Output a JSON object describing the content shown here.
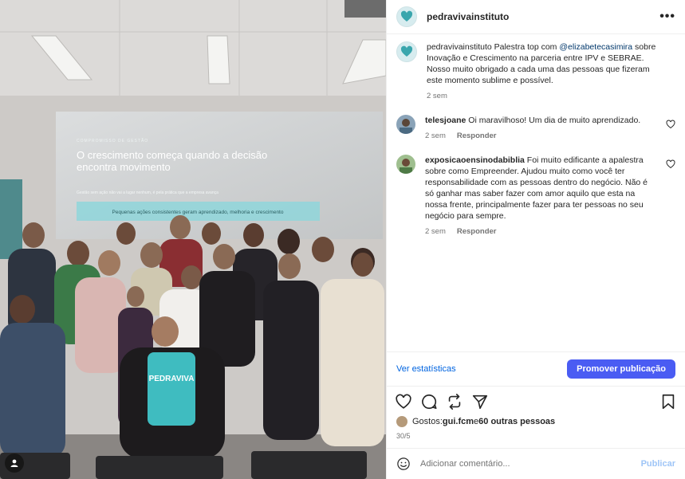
{
  "photo": {
    "slide_kicker": "COMPROMISSO DE GESTÃO",
    "slide_title_line1": "O crescimento começa quando a decisão",
    "slide_title_line2": "encontra movimento",
    "slide_small": "Gestão sem ação não vai a lugar nenhum, é pela prática que a empresa avança",
    "slide_box": "Pequenas ações consistentes geram aprendizado, melhoria e crescimento",
    "shirt_text": "PEDRAVIVA"
  },
  "header": {
    "username": "pedravivainstituto",
    "more_label": "•••"
  },
  "caption": {
    "username": "pedravivainstituto",
    "text_before": " Palestra top com ",
    "mention": "@elizabetecasimira",
    "text_after": " sobre Inovação e Crescimento na parceria entre IPV e SEBRAE. Nosso muito obrigado a cada uma das pessoas que fizeram este momento sublime e possível.",
    "time": "2 sem"
  },
  "comments": [
    {
      "username": "telesjoane",
      "text": " Oi maravilhoso! Um dia de muito aprendizado.",
      "time": "2 sem",
      "reply": "Responder"
    },
    {
      "username": "exposicaoensinodabiblia",
      "text": " Foi muito edificante a apalestra sobre como Empreender. Ajudou muito como você ter responsabilidade com as pessoas dentro do negócio. Não é só ganhar mas saber fazer com amor aquilo que esta na nossa frente, principalmente fazer para ter pessoas no seu negócio para sempre.",
      "time": "2 sem",
      "reply": "Responder"
    }
  ],
  "stats": {
    "link": "Ver estatísticas",
    "promote": "Promover publicação"
  },
  "likes": {
    "prefix": "Gostos: ",
    "user": "gui.fcm",
    "middle": " e ",
    "others": "60 outras pessoas"
  },
  "date": "30/5",
  "add_comment": {
    "placeholder": "Adicionar comentário...",
    "publish": "Publicar"
  },
  "colors": {
    "accent": "#4a5cf3",
    "link": "#0064e0",
    "slide_box": "#8fd6da"
  }
}
